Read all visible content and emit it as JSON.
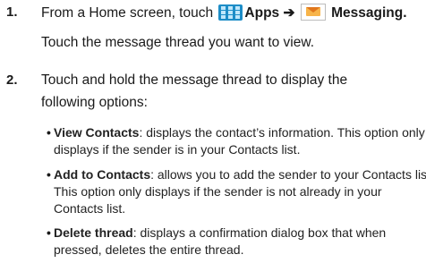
{
  "step1": {
    "number": "1.",
    "line1_prefix": "From a Home screen, touch",
    "apps_label": "Apps",
    "arrow": "➔",
    "messaging_label": "Messaging.",
    "line2": "Touch the message thread you want to view.",
    "apps_icon": "apps-grid-icon",
    "messaging_icon": "messaging-envelope-icon",
    "apps_icon_color": "#1d8dc7",
    "messaging_icon_color": "#f7b44a"
  },
  "step2": {
    "number": "2.",
    "line1": "Touch and hold the message thread to display the",
    "line2": "following options:",
    "bullets": [
      {
        "term": "View Contacts",
        "desc1": ": displays the contact’s information. This option only",
        "desc2": "displays if the sender is in your Contacts list."
      },
      {
        "term": "Add to Contacts",
        "desc1": ": allows you to add the sender to your Contacts list.",
        "desc2": "This option only displays if the sender is not already in your",
        "desc3": "Contacts list."
      },
      {
        "term": "Delete thread",
        "desc1": ": displays a confirmation dialog box that when",
        "desc2": "pressed, deletes the entire thread."
      }
    ]
  },
  "bullet_char": "•"
}
